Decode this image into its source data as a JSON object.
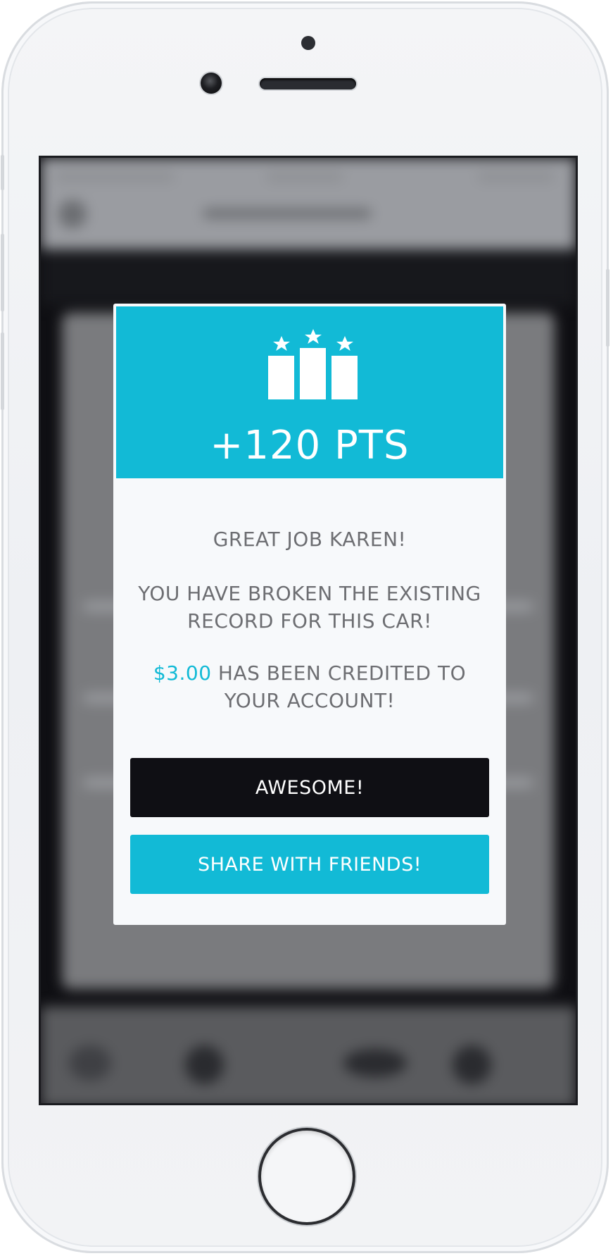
{
  "device": {
    "model_color": "#f4f5f7"
  },
  "modal": {
    "icon": "podium-stars-icon",
    "points": "+120 PTS",
    "greeting": "GREAT JOB KAREN!",
    "record_line1": "YOU HAVE BROKEN THE EXISTING",
    "record_line2": "RECORD FOR THIS CAR!",
    "credit_amount": "$3.00",
    "credit_line1_rest": " HAS BEEN CREDITED TO",
    "credit_line2": "YOUR ACCOUNT!",
    "primary_button": "AWESOME!",
    "secondary_button": "SHARE WITH FRIENDS!"
  },
  "colors": {
    "accent": "#12bad6",
    "dark_button": "#0f0f14",
    "text": "#6d6e72"
  }
}
